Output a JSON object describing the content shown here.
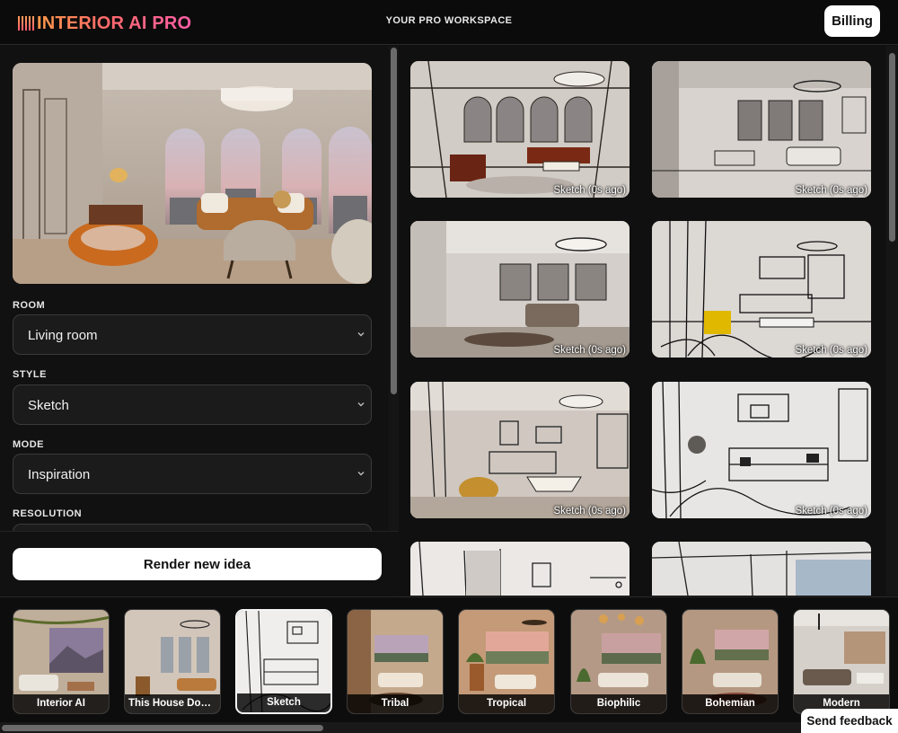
{
  "header": {
    "logo_text": "INTERIOR AI PRO",
    "center_title": "YOUR PRO WORKSPACE",
    "billing_label": "Billing"
  },
  "controls": {
    "room": {
      "label": "ROOM",
      "value": "Living room"
    },
    "style": {
      "label": "STYLE",
      "value": "Sketch"
    },
    "mode": {
      "label": "MODE",
      "value": "Inspiration"
    },
    "resolution": {
      "label": "RESOLUTION",
      "value": ""
    },
    "render_button": "Render new idea"
  },
  "gallery": {
    "items": [
      {
        "caption": "Sketch (0s ago)"
      },
      {
        "caption": "Sketch (0s ago)"
      },
      {
        "caption": "Sketch (0s ago)"
      },
      {
        "caption": "Sketch (0s ago)"
      },
      {
        "caption": "Sketch (0s ago)"
      },
      {
        "caption": "Sketch (0s ago)"
      }
    ]
  },
  "styles": {
    "selected": "Sketch",
    "items": [
      {
        "label": "Interior AI"
      },
      {
        "label": "This House Does Not Exist"
      },
      {
        "label": "Sketch"
      },
      {
        "label": "Tribal"
      },
      {
        "label": "Tropical"
      },
      {
        "label": "Biophilic"
      },
      {
        "label": "Bohemian"
      },
      {
        "label": "Modern"
      }
    ]
  },
  "feedback_label": "Send feedback",
  "colors": {
    "background": "#0f0f0f",
    "panel": "#111111",
    "button_bg": "#ffffff",
    "logo_gradient_start": "#ff9a4a",
    "logo_gradient_end": "#ff5fa8"
  }
}
